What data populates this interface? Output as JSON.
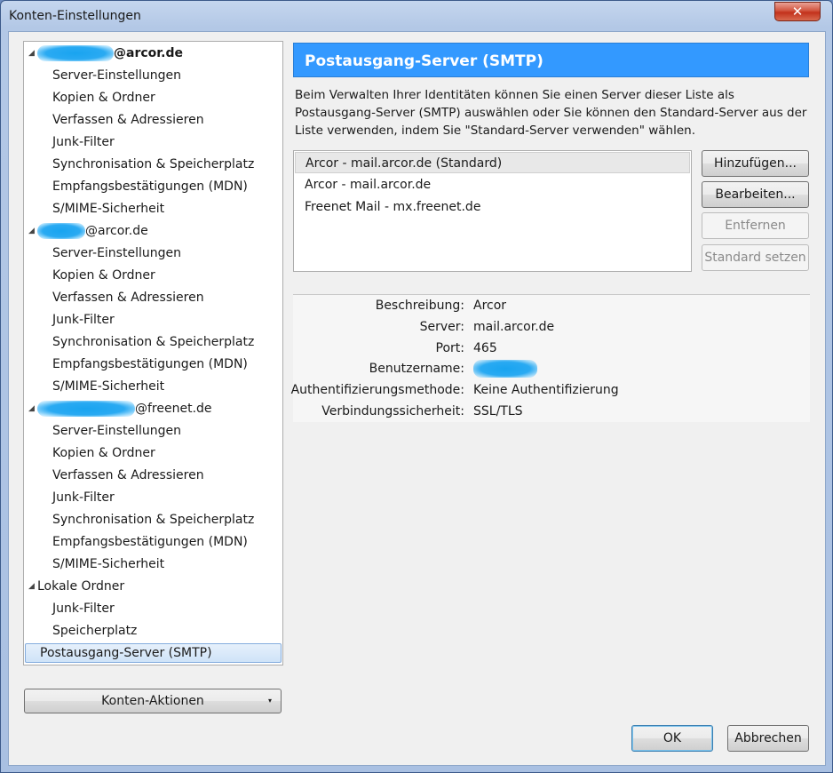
{
  "window": {
    "title": "Konten-Einstellungen",
    "close_glyph": "✕"
  },
  "tree": {
    "accounts": [
      {
        "name_suffix": "@arcor.de",
        "bold": true,
        "items": [
          "Server-Einstellungen",
          "Kopien & Ordner",
          "Verfassen & Adressieren",
          "Junk-Filter",
          "Synchronisation & Speicherplatz",
          "Empfangsbestätigungen (MDN)",
          "S/MIME-Sicherheit"
        ]
      },
      {
        "name_suffix": "@arcor.de",
        "bold": false,
        "items": [
          "Server-Einstellungen",
          "Kopien & Ordner",
          "Verfassen & Adressieren",
          "Junk-Filter",
          "Synchronisation & Speicherplatz",
          "Empfangsbestätigungen (MDN)",
          "S/MIME-Sicherheit"
        ]
      },
      {
        "name_suffix": "@freenet.de",
        "bold": false,
        "items": [
          "Server-Einstellungen",
          "Kopien & Ordner",
          "Verfassen & Adressieren",
          "Junk-Filter",
          "Synchronisation & Speicherplatz",
          "Empfangsbestätigungen (MDN)",
          "S/MIME-Sicherheit"
        ]
      }
    ],
    "local_folder": {
      "label": "Lokale Ordner",
      "items": [
        "Junk-Filter",
        "Speicherplatz"
      ]
    },
    "smtp_item": "Postausgang-Server (SMTP)",
    "expander_glyph": "◢"
  },
  "account_actions_button": {
    "label": "Konten-Aktionen",
    "arrow": "▾"
  },
  "panel": {
    "header": "Postausgang-Server (SMTP)",
    "description": "Beim Verwalten Ihrer Identitäten können Sie einen Server dieser Liste als Postausgang-Server (SMTP) auswählen oder Sie können den Standard-Server aus der Liste verwenden, indem Sie \"Standard-Server verwenden\" wählen.",
    "servers": [
      "Arcor - mail.arcor.de (Standard)",
      "Arcor - mail.arcor.de",
      "Freenet Mail - mx.freenet.de"
    ],
    "buttons": {
      "add": "Hinzufügen...",
      "edit": "Bearbeiten...",
      "remove": "Entfernen",
      "set_default": "Standard setzen"
    },
    "details": {
      "description_label": "Beschreibung:",
      "description_value": "Arcor",
      "server_label": "Server:",
      "server_value": "mail.arcor.de",
      "port_label": "Port:",
      "port_value": "465",
      "username_label": "Benutzername:",
      "auth_label": "Authentifizierungsmethode:",
      "auth_value": "Keine Authentifizierung",
      "security_label": "Verbindungssicherheit:",
      "security_value": "SSL/TLS"
    }
  },
  "dialog_buttons": {
    "ok": "OK",
    "cancel": "Abbrechen"
  }
}
